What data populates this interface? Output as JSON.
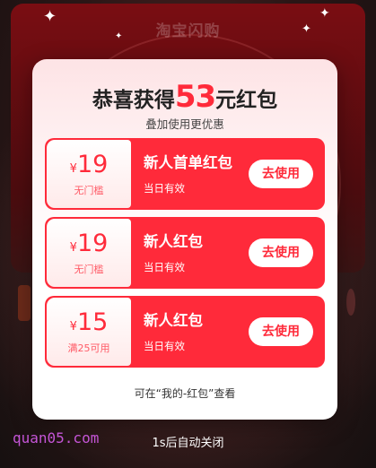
{
  "background": {
    "title": "淘宝闪购"
  },
  "modal": {
    "headline_prefix": "恭喜获得",
    "headline_amount": "53",
    "headline_suffix": "元红包",
    "subtitle": "叠加使用更优惠",
    "coupons": [
      {
        "currency": "¥",
        "value": "19",
        "condition": "无门槛",
        "name": "新人首单红包",
        "validity": "当日有效",
        "button": "去使用"
      },
      {
        "currency": "¥",
        "value": "19",
        "condition": "无门槛",
        "name": "新人红包",
        "validity": "当日有效",
        "button": "去使用"
      },
      {
        "currency": "¥",
        "value": "15",
        "condition": "满25可用",
        "name": "新人红包",
        "validity": "当日有效",
        "button": "去使用"
      }
    ],
    "footnote": "可在“我的-红包”查看"
  },
  "auto_close": "1s后自动关闭",
  "watermark": "quan05.com",
  "colors": {
    "accent": "#ff2a3a",
    "modal_bg": "#ffffff",
    "overlay": "#1a1212"
  }
}
